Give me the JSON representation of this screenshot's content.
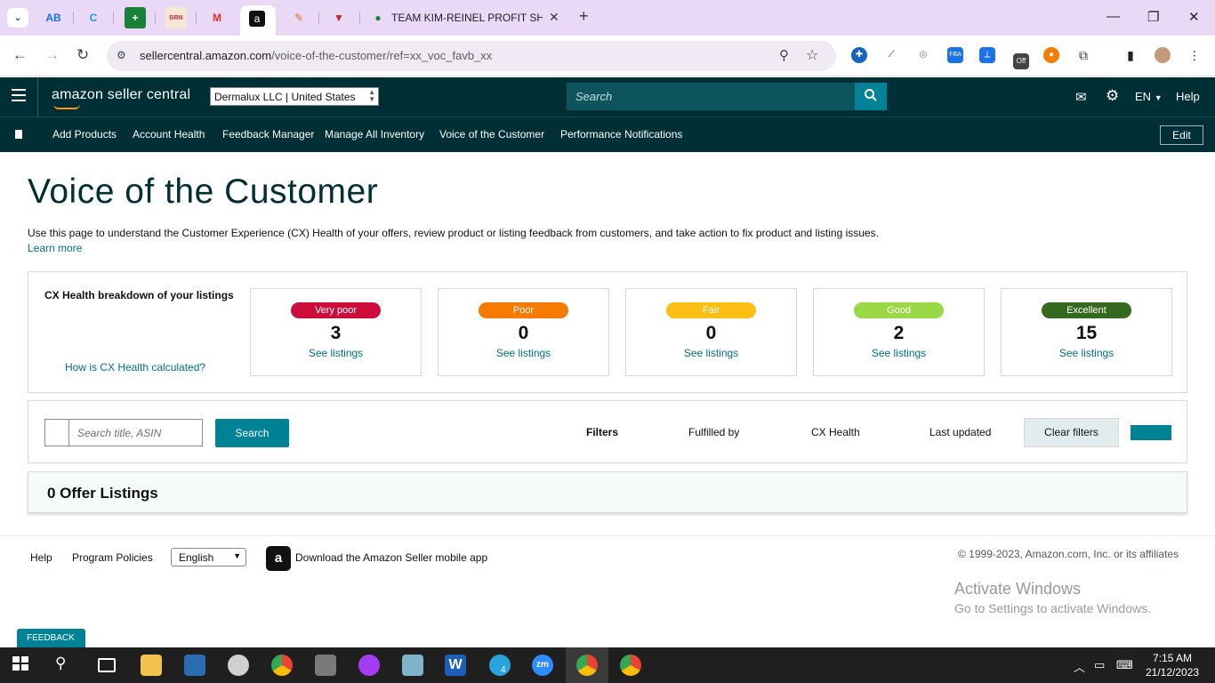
{
  "browser": {
    "tab_title": "TEAM KIM-REINEL PROFIT SHEE",
    "url_host": "sellercentral.amazon.com",
    "url_path": "/voice-of-the-customer/ref=xx_voc_favb_xx"
  },
  "header": {
    "logo": "amazon seller central",
    "account": "Dermalux LLC | United States",
    "search_placeholder": "Search",
    "lang": "EN",
    "help": "Help"
  },
  "nav": {
    "items": [
      "Add Products",
      "Account Health",
      "Feedback Manager",
      "Manage All Inventory",
      "Voice of the Customer",
      "Performance Notifications"
    ],
    "edit": "Edit"
  },
  "page": {
    "title": "Voice of the Customer",
    "intro": "Use this page to understand the Customer Experience (CX) Health of your offers, review product or listing feedback from customers, and take action to fix product and listing issues.",
    "learn_more": "Learn more"
  },
  "cx": {
    "heading": "CX Health breakdown of your listings",
    "how": "How is CX Health calculated?",
    "cards": [
      {
        "label": "Very poor",
        "count": "3",
        "link": "See listings",
        "color": "#cc0c39"
      },
      {
        "label": "Poor",
        "count": "0",
        "link": "See listings",
        "color": "#f67b00"
      },
      {
        "label": "Fair",
        "count": "0",
        "link": "See listings",
        "color": "#fcbf13"
      },
      {
        "label": "Good",
        "count": "2",
        "link": "See listings",
        "color": "#9bd846"
      },
      {
        "label": "Excellent",
        "count": "15",
        "link": "See listings",
        "color": "#34691f"
      }
    ]
  },
  "filters": {
    "search_placeholder": "Search title, ASIN",
    "search_button": "Search",
    "filters_label": "Filters",
    "fulfilled_by": "Fulfilled by",
    "cx_health": "CX Health",
    "last_updated": "Last updated",
    "clear": "Clear filters"
  },
  "offers": {
    "title": "0 Offer Listings"
  },
  "footer": {
    "help": "Help",
    "policies": "Program Policies",
    "language": "English",
    "app": "Download the Amazon Seller mobile app",
    "copyright": "© 1999-2023, Amazon.com, Inc. or its affiliates"
  },
  "windows": {
    "activate_title": "Activate Windows",
    "activate_sub": "Go to Settings to activate Windows."
  },
  "feedback": "FEEDBACK",
  "taskbar": {
    "time": "7:15 AM",
    "date": "21/12/2023",
    "telegram_badge": "4"
  }
}
